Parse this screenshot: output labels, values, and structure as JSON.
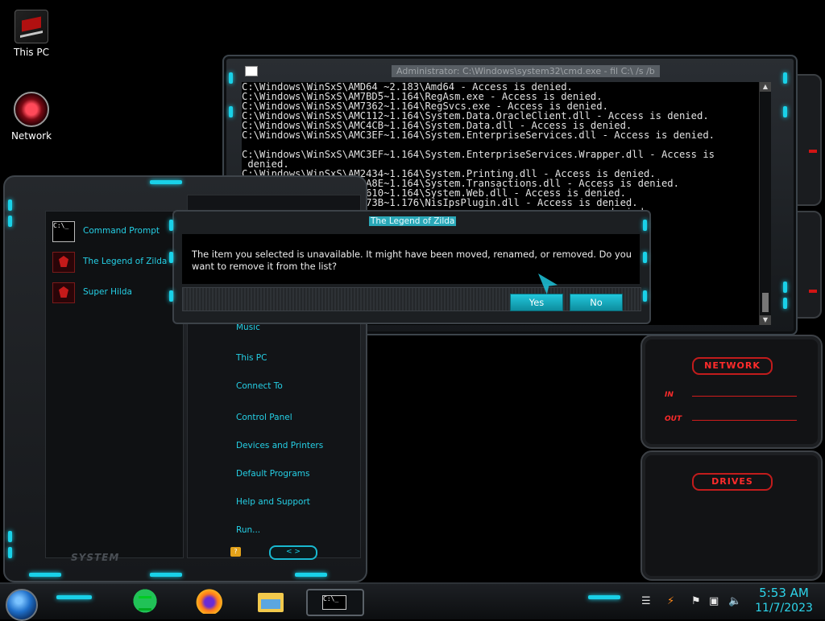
{
  "desktop": {
    "icons": [
      {
        "label": "This PC"
      },
      {
        "label": "Network"
      }
    ]
  },
  "console": {
    "title": "Administrator: C:\\Windows\\system32\\cmd.exe - fil  C:\\ /s /b",
    "icon_text": "C:\\_",
    "lines": [
      "C:\\Windows\\WinSxS\\AMD64_~2.183\\Amd64 - Access is denied.",
      "C:\\Windows\\WinSxS\\AM7BD5~1.164\\RegAsm.exe - Access is denied.",
      "C:\\Windows\\WinSxS\\AM7362~1.164\\RegSvcs.exe - Access is denied.",
      "C:\\Windows\\WinSxS\\AMC112~1.164\\System.Data.OracleClient.dll - Access is denied.",
      "C:\\Windows\\WinSxS\\AMC4CB~1.164\\System.Data.dll - Access is denied.",
      "C:\\Windows\\WinSxS\\AMC3EF~1.164\\System.EnterpriseServices.dll - Access is denied.",
      "",
      "C:\\Windows\\WinSxS\\AMC3EF~1.164\\System.EnterpriseServices.Wrapper.dll - Access is",
      " denied.",
      "C:\\Windows\\WinSxS\\AM2434~1.164\\System.Printing.dll - Access is denied.",
      "C:\\Windows\\WinSxS\\AM3A8E~1.164\\System.Transactions.dll - Access is denied.",
      "C:\\Windows\\WinSxS\\AM4610~1.164\\System.Web.dll - Access is denied.",
      "C:\\Windows\\WinSxS\\AM973B~1.176\\NisIpsPlugin.dll - Access is denied.",
      "                                                              denied.",
      "",
      "",
      "",
      "",
      "",
      "",
      "                                                              denied."
    ]
  },
  "gadget": {
    "network_title": "NETWORK",
    "in_label": "IN",
    "out_label": "OUT",
    "drives_title": "DRIVES"
  },
  "start_menu": {
    "programs": [
      {
        "label": "Command Prompt",
        "icon": "cmd-icon",
        "icon_text": "C:\\_"
      },
      {
        "label": "The Legend of Zilda",
        "icon": "game-icon"
      },
      {
        "label": "Super Hilda",
        "icon": "game-icon"
      }
    ],
    "right_links": [
      "Music",
      "This PC",
      "Connect To",
      "Control Panel",
      "Devices and Printers",
      "Default Programs",
      "Help and Support",
      "Run..."
    ],
    "system_label": "SYSTEM",
    "nav_label": "< >",
    "help_label": "?"
  },
  "dialog": {
    "title": "The Legend of Zilda",
    "message": "The item you selected is unavailable.  It might have been moved, renamed, or removed.  Do you want to remove it from the list?",
    "yes_label": "Yes",
    "no_label": "No"
  },
  "taskbar": {
    "apps": [
      {
        "name": "spotify-icon"
      },
      {
        "name": "firefox-icon"
      },
      {
        "name": "file-explorer-icon"
      },
      {
        "name": "command-prompt-icon",
        "icon_text": "C:\\_"
      }
    ],
    "tray_icons": [
      "action-center-icon",
      "power-icon",
      "flag-icon",
      "network-icon",
      "volume-icon"
    ],
    "clock_time": "5:53 AM",
    "clock_date": "11/7/2023"
  },
  "colors": {
    "accent_cyan": "#19d1e8",
    "accent_red": "#d11c1c",
    "background": "#000000"
  }
}
